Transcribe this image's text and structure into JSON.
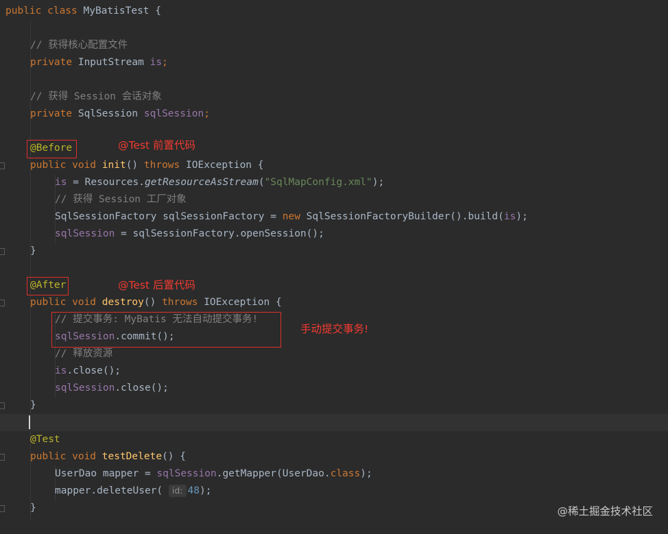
{
  "code": {
    "l1": {
      "kw": "public class",
      "name": " MyBatisTest {"
    },
    "l3": {
      "comment": "// 获得核心配置文件"
    },
    "l4": {
      "kw": "private",
      "type": " InputStream ",
      "field": "is",
      "end": ";"
    },
    "l6": {
      "comment": "// 获得 Session 会话对象"
    },
    "l7": {
      "kw": "private",
      "type": " SqlSession ",
      "field": "sqlSession",
      "end": ";"
    },
    "l9": {
      "ann": "@Before"
    },
    "l10": {
      "kw1": "public void",
      "fn": "init",
      "paren": "() ",
      "kw2": "throws",
      "rest": " IOException {"
    },
    "l11": {
      "field": "is",
      "mid": " = Resources.",
      "method": "getResourceAsStream",
      "open": "(",
      "str": "\"SqlMapConfig.xml\"",
      "close": ");"
    },
    "l12": {
      "comment": "// 获得 Session 工厂对象"
    },
    "l13": {
      "type": "SqlSessionFactory sqlSessionFactory = ",
      "kw": "new",
      "mid": " SqlSessionFactoryBuilder().build(",
      "field": "is",
      "end": ");"
    },
    "l14": {
      "field": "sqlSession",
      "rest": " = sqlSessionFactory.openSession();"
    },
    "l15": {
      "brace": "}"
    },
    "l17": {
      "ann": "@After"
    },
    "l18": {
      "kw1": "public void",
      "fn": "destroy",
      "paren": "() ",
      "kw2": "throws",
      "rest": " IOException {"
    },
    "l19": {
      "comment": "// 提交事务: MyBatis 无法自动提交事务!"
    },
    "l20": {
      "field": "sqlSession",
      "rest": ".commit();"
    },
    "l21": {
      "comment": "// 释放资源"
    },
    "l22": {
      "field": "is",
      "rest": ".close();"
    },
    "l23": {
      "field": "sqlSession",
      "rest": ".close();"
    },
    "l24": {
      "brace": "}"
    },
    "l26": {
      "ann": "@Test"
    },
    "l27": {
      "kw1": "public void",
      "fn": "testDelete",
      "rest": "() {"
    },
    "l28": {
      "start": "UserDao mapper = ",
      "field": "sqlSession",
      "mid": ".getMapper(UserDao.",
      "kw": "class",
      "end": ");"
    },
    "l29": {
      "start": "mapper.deleteUser( ",
      "hint": "id:",
      "num": "48",
      "end": ");"
    },
    "l30": {
      "brace": "}"
    }
  },
  "annotations": {
    "before_label": "@Test 前置代码",
    "after_label": "@Test 后置代码",
    "commit_label": "手动提交事务!",
    "color": "#e0302a"
  },
  "watermark": "@稀土掘金技术社区",
  "theme": {
    "background": "#2b2b2b",
    "keyword": "#cc7832",
    "annotation": "#bbb529",
    "field": "#9876aa",
    "string": "#6a8759",
    "comment": "#808080",
    "method": "#ffc66d",
    "number": "#6897bb"
  }
}
